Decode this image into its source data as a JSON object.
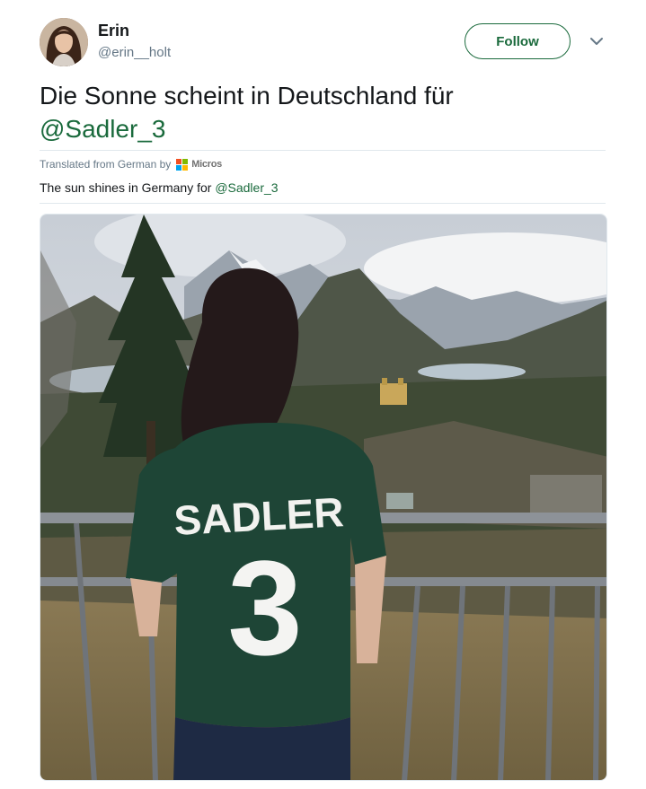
{
  "user": {
    "name": "Erin",
    "handle": "@erin__holt"
  },
  "follow_label": "Follow",
  "tweet": {
    "text": "Die Sonne scheint in Deutschland für ",
    "mention": "@Sadler_3"
  },
  "translation": {
    "label": "Translated from German by",
    "provider": "Micros",
    "text": "The sun shines in Germany for ",
    "mention": "@Sadler_3"
  },
  "photo": {
    "jersey_name": "SADLER",
    "jersey_number": "3"
  },
  "colors": {
    "accent": "#1a6a3c",
    "secondary_text": "#657786",
    "divider": "#e1e8ed"
  }
}
